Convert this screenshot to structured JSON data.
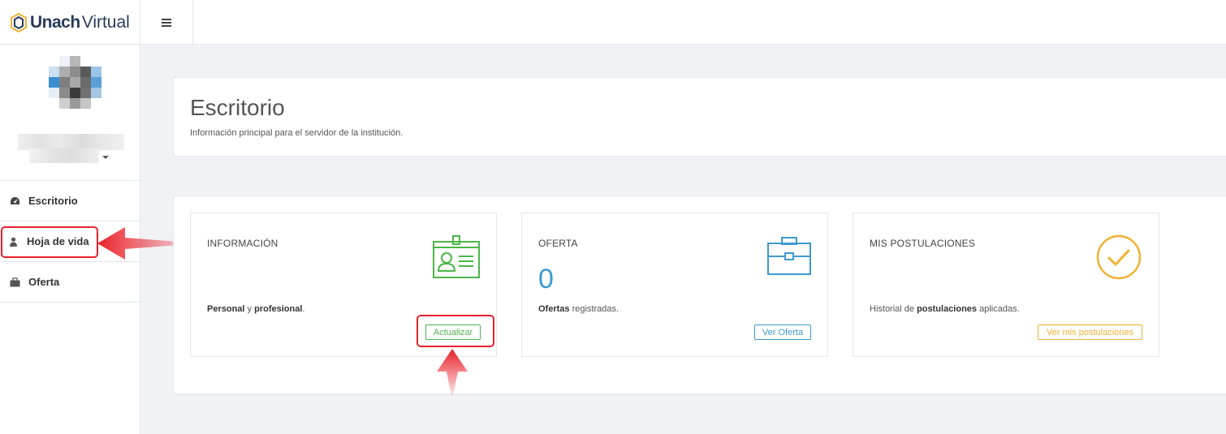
{
  "brand": {
    "name_bold": "Unach",
    "name_light": "Virtual"
  },
  "sidebar": {
    "items": [
      {
        "label": "Escritorio",
        "icon": "dashboard-icon"
      },
      {
        "label": "Hoja de vida",
        "icon": "user-icon"
      },
      {
        "label": "Oferta",
        "icon": "briefcase-icon"
      }
    ]
  },
  "header": {
    "title": "Escritorio",
    "subtitle": "Información principal para el servidor de la institución."
  },
  "cards": [
    {
      "title": "INFORMACIÓN",
      "desc_bold1": "Personal",
      "desc_mid": " y ",
      "desc_bold2": "profesional",
      "desc_end": ".",
      "button": "Actualizar",
      "color": "#4cb648",
      "icon": "id-card-icon"
    },
    {
      "title": "OFERTA",
      "number": "0",
      "desc_bold1": "Ofertas",
      "desc_end": " registradas.",
      "button": "Ver Oferta",
      "color": "#3d9ad1",
      "icon": "briefcase-icon"
    },
    {
      "title": "MIS POSTULACIONES",
      "desc_start": "Historial de ",
      "desc_bold1": "postulaciones",
      "desc_end": " aplicadas.",
      "button": "Ver mis postulaciones",
      "color": "#f0b132",
      "icon": "check-circle-icon"
    }
  ],
  "colors": {
    "annotation": "#e8212b",
    "brand": "#2a3a5a"
  }
}
